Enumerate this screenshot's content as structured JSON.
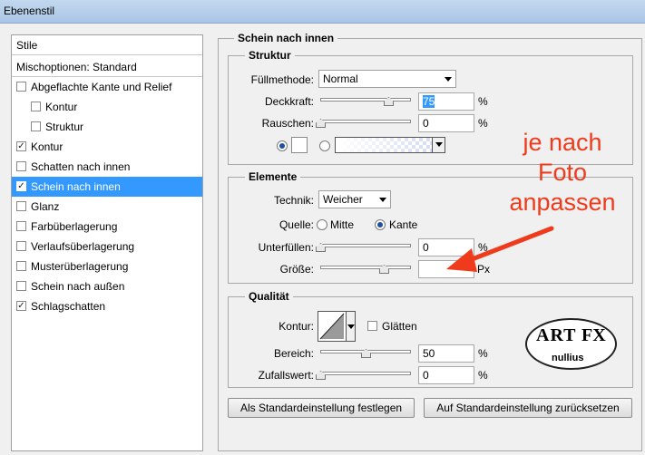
{
  "window": {
    "title": "Ebenenstil"
  },
  "sidebar": {
    "header": "Stile",
    "items": [
      {
        "label": "Mischoptionen: Standard",
        "checkbox": false,
        "checked": false,
        "indent": 0
      },
      {
        "label": "Abgeflachte Kante und Relief",
        "checkbox": true,
        "checked": false,
        "indent": 0
      },
      {
        "label": "Kontur",
        "checkbox": true,
        "checked": false,
        "indent": 1
      },
      {
        "label": "Struktur",
        "checkbox": true,
        "checked": false,
        "indent": 1
      },
      {
        "label": "Kontur",
        "checkbox": true,
        "checked": true,
        "indent": 0
      },
      {
        "label": "Schatten nach innen",
        "checkbox": true,
        "checked": false,
        "indent": 0
      },
      {
        "label": "Schein nach innen",
        "checkbox": true,
        "checked": true,
        "indent": 0,
        "selected": true
      },
      {
        "label": "Glanz",
        "checkbox": true,
        "checked": false,
        "indent": 0
      },
      {
        "label": "Farbüberlagerung",
        "checkbox": true,
        "checked": false,
        "indent": 0
      },
      {
        "label": "Verlaufsüberlagerung",
        "checkbox": true,
        "checked": false,
        "indent": 0
      },
      {
        "label": "Musterüberlagerung",
        "checkbox": true,
        "checked": false,
        "indent": 0
      },
      {
        "label": "Schein nach außen",
        "checkbox": true,
        "checked": false,
        "indent": 0
      },
      {
        "label": "Schlagschatten",
        "checkbox": true,
        "checked": true,
        "indent": 0
      }
    ]
  },
  "panel": {
    "title": "Schein nach innen",
    "struktur": {
      "title": "Struktur",
      "fuellmethode_label": "Füllmethode:",
      "fuellmethode_value": "Normal",
      "deckkraft_label": "Deckkraft:",
      "deckkraft_value": "75",
      "deckkraft_level": 75,
      "rauschen_label": "Rauschen:",
      "rauschen_value": "0",
      "rauschen_level": 0,
      "percent": "%"
    },
    "elemente": {
      "title": "Elemente",
      "technik_label": "Technik:",
      "technik_value": "Weicher",
      "quelle_label": "Quelle:",
      "quelle_mitte": "Mitte",
      "quelle_kante": "Kante",
      "unterfuellen_label": "Unterfüllen:",
      "unterfuellen_value": "0",
      "unterfuellen_level": 0,
      "groesse_label": "Größe:",
      "groesse_value": "",
      "groesse_level": 70,
      "percent": "%",
      "px": "Px"
    },
    "qualitaet": {
      "title": "Qualität",
      "kontur_label": "Kontur:",
      "glaetten_label": "Glätten",
      "bereich_label": "Bereich:",
      "bereich_value": "50",
      "bereich_level": 50,
      "zufallswert_label": "Zufallswert:",
      "zufallswert_value": "0",
      "zufallswert_level": 0,
      "percent": "%"
    },
    "buttons": {
      "standard_set": "Als Standardeinstellung festlegen",
      "standard_reset": "Auf Standardeinstellung zurücksetzen"
    }
  },
  "annotation": {
    "line1": "je nach",
    "line2": "Foto",
    "line3": "anpassen",
    "color": "#ef3b1c"
  },
  "logo": {
    "line1": "ART",
    "line2": "FX",
    "line3": "nullius"
  },
  "colors": {
    "selection": "#3399ff",
    "accent": "#1e4fa0"
  }
}
